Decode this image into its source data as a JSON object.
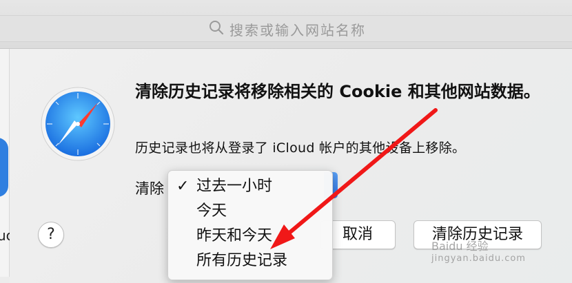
{
  "toolbar": {
    "search_placeholder": "搜索或输入网站名称",
    "search_icon": "search-icon"
  },
  "background_page": {
    "partial_text": "uc"
  },
  "dialog": {
    "title": "清除历史记录将移除相关的 Cookie 和其他网站数据。",
    "subtitle": "历史记录也将从登录了 iCloud 帐户的其他设备上移除。",
    "clear_label": "清除",
    "popup": {
      "options": [
        {
          "label": "过去一小时",
          "checked": true
        },
        {
          "label": "今天",
          "checked": false
        },
        {
          "label": "昨天和今天",
          "checked": false
        },
        {
          "label": "所有历史记录",
          "checked": false
        }
      ],
      "check_glyph": "✓"
    },
    "help_label": "?",
    "cancel_label": "取消",
    "clear_button_label": "清除历史记录"
  },
  "annotation": {
    "arrow_color": "#f01818"
  },
  "watermark": {
    "line1": "Baidu 经验",
    "line2": "jingyan.baidu.com"
  },
  "colors": {
    "accent": "#2f74e5"
  }
}
